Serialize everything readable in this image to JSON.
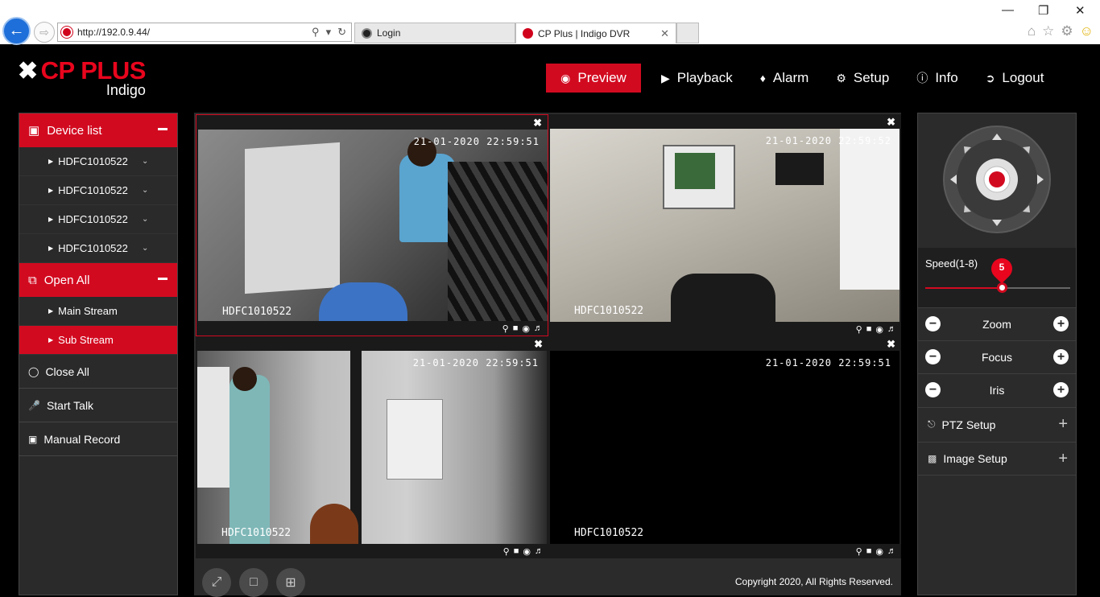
{
  "browser": {
    "url": "http://192.0.9.44/",
    "tabs": [
      {
        "label": "Login"
      },
      {
        "label": "CP Plus | Indigo DVR"
      }
    ]
  },
  "app": {
    "brand": "CP PLUS",
    "subbrand": "Indigo",
    "nav": [
      {
        "label": "Preview",
        "icon": "eye-icon",
        "active": true
      },
      {
        "label": "Playback",
        "icon": "play-icon"
      },
      {
        "label": "Alarm",
        "icon": "bell-icon"
      },
      {
        "label": "Setup",
        "icon": "gear-icon"
      },
      {
        "label": "Info",
        "icon": "info-icon"
      },
      {
        "label": "Logout",
        "icon": "logout-icon"
      }
    ]
  },
  "sidebar": {
    "device_list_label": "Device list",
    "devices": [
      "HDFC1010522",
      "HDFC1010522",
      "HDFC1010522",
      "HDFC1010522"
    ],
    "open_all_label": "Open All",
    "streams": [
      {
        "label": "Main Stream",
        "selected": false
      },
      {
        "label": "Sub Stream",
        "selected": true
      }
    ],
    "close_all_label": "Close All",
    "start_talk_label": "Start Talk",
    "manual_record_label": "Manual Record"
  },
  "cameras": [
    {
      "timestamp": "21-01-2020 22:59:51",
      "name": "HDFC1010522",
      "selected": true
    },
    {
      "timestamp": "21-01-2020 22:59:52",
      "name": "HDFC1010522",
      "selected": false
    },
    {
      "timestamp": "21-01-2020 22:59:51",
      "name": "HDFC1010522",
      "selected": false
    },
    {
      "timestamp": "21-01-2020 22:59:51",
      "name": "HDFC1010522",
      "selected": false
    }
  ],
  "footer": {
    "copyright": "Copyright 2020, All Rights Reserved."
  },
  "ptz": {
    "speed_label": "Speed(1-8)",
    "speed_value": "5",
    "speed_min": 1,
    "speed_max": 8,
    "zoom_label": "Zoom",
    "focus_label": "Focus",
    "iris_label": "Iris",
    "ptz_setup_label": "PTZ Setup",
    "image_setup_label": "Image Setup"
  },
  "colors": {
    "accent": "#d20a20",
    "panel": "#2b2b2b"
  }
}
